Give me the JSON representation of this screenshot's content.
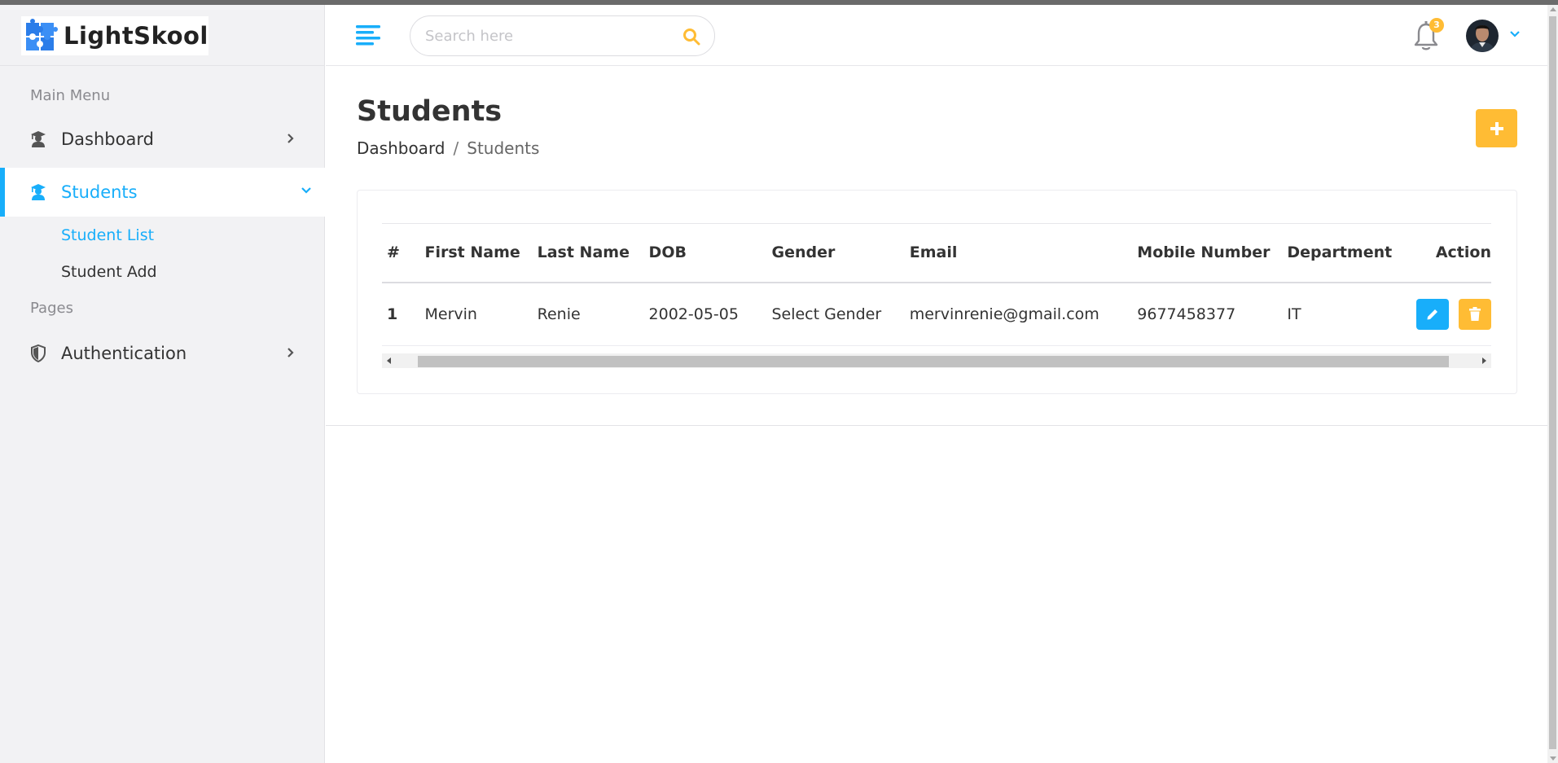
{
  "brand": {
    "name": "LightSkool"
  },
  "sidebar": {
    "section_main": "Main Menu",
    "section_pages": "Pages",
    "items": [
      {
        "label": "Dashboard",
        "icon": "graduation-cap-user-icon"
      },
      {
        "label": "Students",
        "icon": "graduation-cap-user-icon",
        "active": true,
        "children": [
          {
            "label": "Student List",
            "active": true
          },
          {
            "label": "Student Add"
          }
        ]
      },
      {
        "label": "Authentication",
        "icon": "shield-icon"
      }
    ]
  },
  "header": {
    "search_placeholder": "Search here",
    "notification_count": "3"
  },
  "page": {
    "title": "Students",
    "breadcrumb": [
      "Dashboard",
      "/",
      "Students"
    ]
  },
  "table": {
    "columns": [
      "#",
      "First Name",
      "Last Name",
      "DOB",
      "Gender",
      "Email",
      "Mobile Number",
      "Department",
      "Action"
    ],
    "rows": [
      {
        "num": "1",
        "first": "Mervin",
        "last": "Renie",
        "dob": "2002-05-05",
        "gender": "Select Gender",
        "email": "mervinrenie@gmail.com",
        "mobile": "9677458377",
        "dept": "IT"
      }
    ]
  },
  "colors": {
    "accent": "#18aefa",
    "warning": "#ffbc34",
    "sidebar_bg": "#f2f2f4"
  }
}
